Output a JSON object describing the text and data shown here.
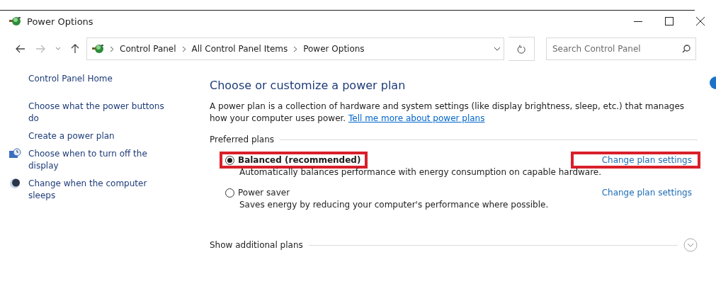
{
  "window": {
    "title": "Power Options"
  },
  "address_bar": {
    "crumbs": [
      "Control Panel",
      "All Control Panel Items",
      "Power Options"
    ]
  },
  "search": {
    "placeholder": "Search Control Panel"
  },
  "sidebar": {
    "items": [
      {
        "label": "Control Panel Home",
        "kind": "home"
      },
      {
        "label": "Choose what the power buttons do",
        "kind": "plain"
      },
      {
        "label": "Create a power plan",
        "kind": "plain"
      },
      {
        "label": "Choose when to turn off the display",
        "kind": "display"
      },
      {
        "label": "Change when the computer sleeps",
        "kind": "sleep"
      }
    ]
  },
  "main": {
    "heading": "Choose or customize a power plan",
    "description": "A power plan is a collection of hardware and system settings (like display brightness, sleep, etc.) that manages how your computer uses power.",
    "link": "Tell me more about power plans",
    "group_label": "Preferred plans",
    "plans": [
      {
        "name": "Balanced (recommended)",
        "selected": true,
        "highlighted": true,
        "link": "Change plan settings",
        "link_highlighted": true,
        "description": "Automatically balances performance with energy consumption on capable hardware."
      },
      {
        "name": "Power saver",
        "selected": false,
        "highlighted": false,
        "link": "Change plan settings",
        "link_highlighted": false,
        "description": "Saves energy by reducing your computer's performance where possible."
      }
    ],
    "more_label": "Show additional plans"
  }
}
